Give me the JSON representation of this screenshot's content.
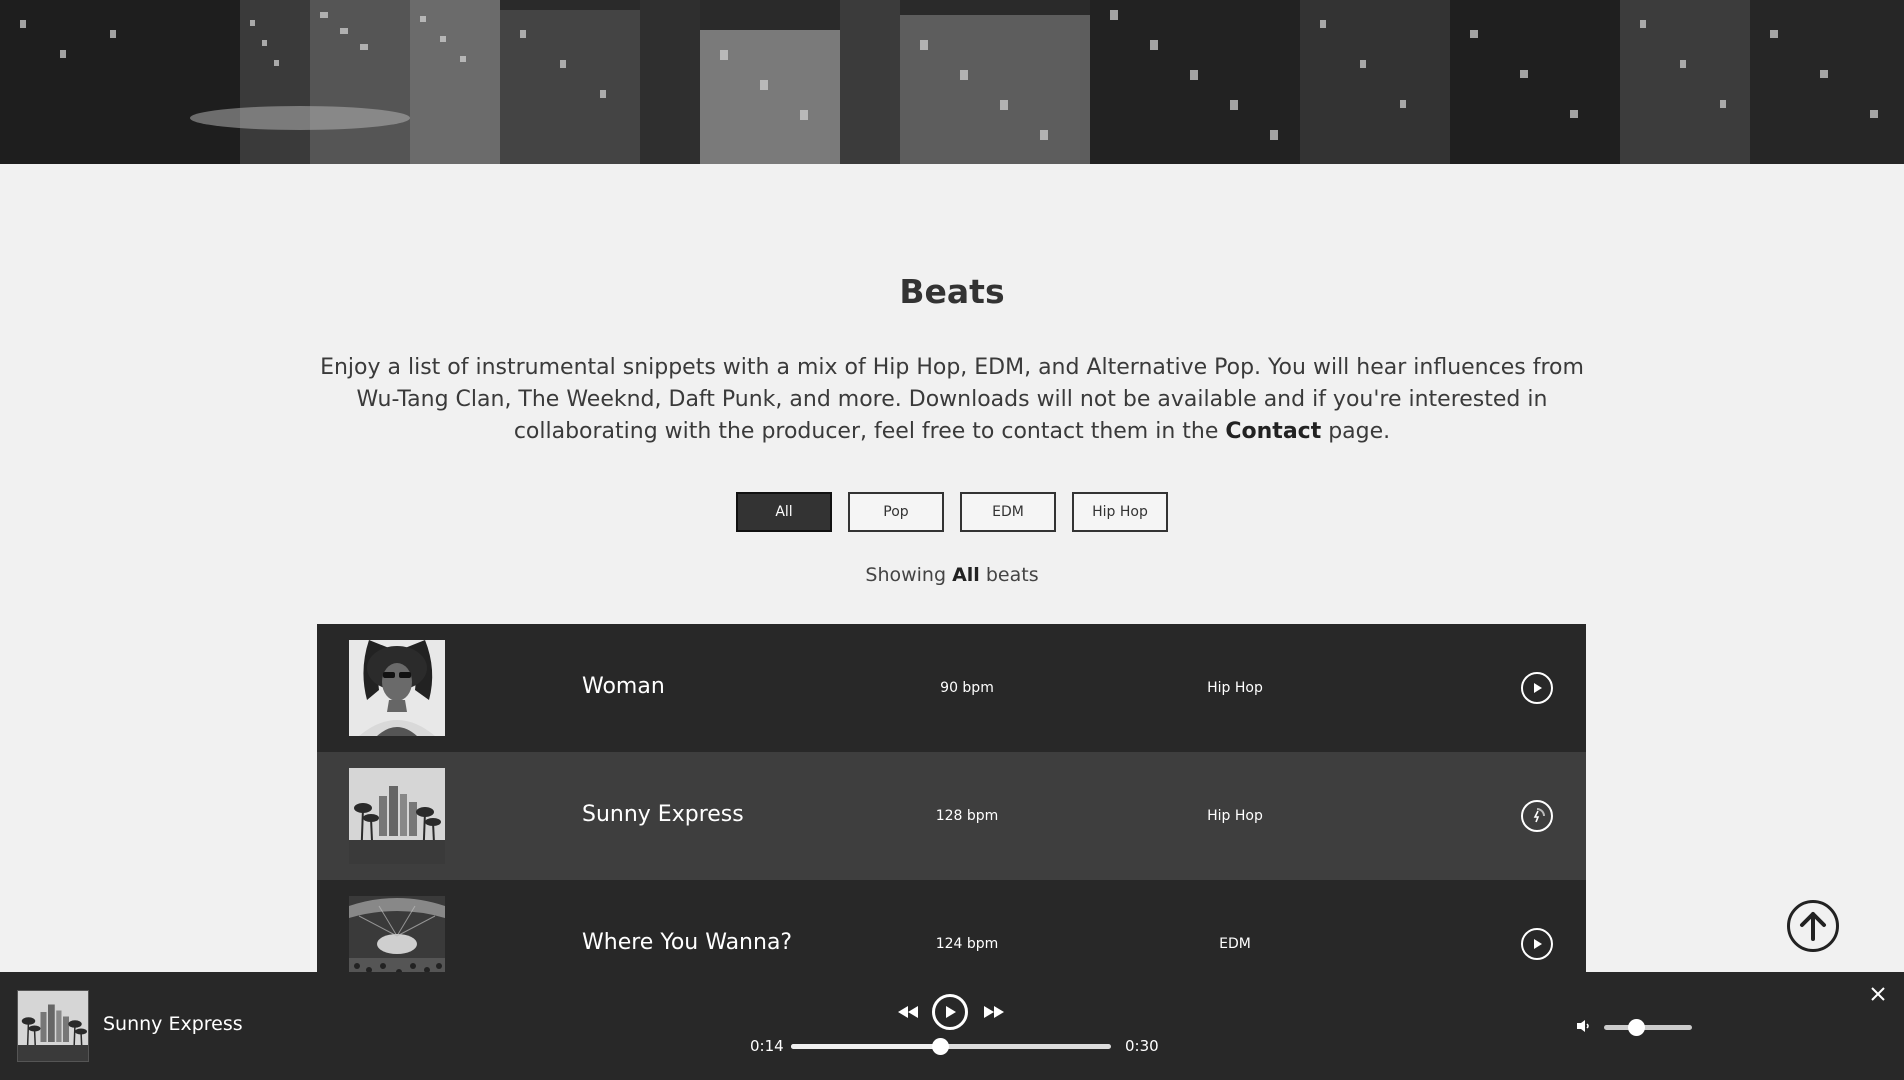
{
  "page": {
    "title": "Beats",
    "intro_text": "Enjoy a list of instrumental snippets with a mix of Hip Hop, EDM, and Alternative Pop. You will hear influences from Wu-Tang Clan, The Weeknd, Daft Punk, and more. Downloads will not be available and if you're interested in collaborating with the producer, feel free to contact them in the ",
    "intro_link": "Contact",
    "intro_end": " page."
  },
  "filters": [
    {
      "label": "All",
      "active": true
    },
    {
      "label": "Pop",
      "active": false
    },
    {
      "label": "EDM",
      "active": false
    },
    {
      "label": "Hip Hop",
      "active": false
    }
  ],
  "showing": {
    "prefix": "Showing ",
    "filter": "All",
    "suffix": " beats"
  },
  "beats": [
    {
      "name": "Woman",
      "bpm": "90 bpm",
      "genre": "Hip Hop",
      "cover_icon": "portrait-image",
      "state": "idle"
    },
    {
      "name": "Sunny Express",
      "bpm": "128 bpm",
      "genre": "Hip Hop",
      "cover_icon": "city-palms-image",
      "state": "playing"
    },
    {
      "name": "Where You Wanna?",
      "bpm": "124 bpm",
      "genre": "EDM",
      "cover_icon": "concert-crowd-image",
      "state": "idle"
    }
  ],
  "player": {
    "track_title": "Sunny Express",
    "current_time": "0:14",
    "duration": "0:30",
    "progress_fraction": 0.467,
    "volume_fraction": 0.36
  },
  "colors": {
    "dark": "#282828",
    "row_active": "#3e3e3e",
    "page_bg": "#f1f1f1"
  }
}
